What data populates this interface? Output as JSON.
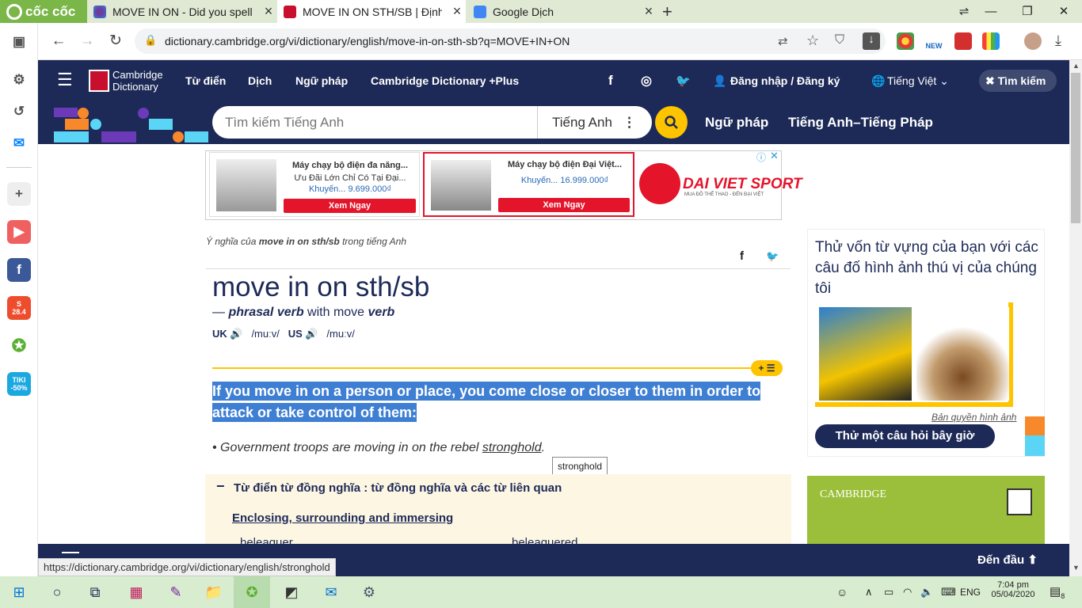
{
  "browser": {
    "brand": "cốc cốc",
    "tabs": [
      {
        "title": "MOVE IN ON - Did you spell i",
        "active": false,
        "icon": "search-globe-icon"
      },
      {
        "title": "MOVE IN ON STH/SB | Định n",
        "active": true,
        "icon": "cambridge-shield-icon"
      },
      {
        "title": "Google Dịch",
        "active": false,
        "icon": "google-translate-icon"
      }
    ],
    "url": "dictionary.cambridge.org/vi/dictionary/english/move-in-on-sth-sb?q=MOVE+IN+ON",
    "status_url": "https://dictionary.cambridge.org/vi/dictionary/english/stronghold",
    "new_badge": "NEW"
  },
  "sidebar": {
    "shopee_badge": "28.4",
    "tiki_badge": "TIKI -50%"
  },
  "site": {
    "logo_line1": "Cambridge",
    "logo_line2": "Dictionary",
    "nav": [
      "Từ điển",
      "Dịch",
      "Ngữ pháp",
      "Cambridge Dictionary +Plus"
    ],
    "login": "Đăng nhập / Đăng ký",
    "language": "Tiếng Việt",
    "search_toggle": "Tìm kiếm",
    "search_placeholder": "Tìm kiếm Tiếng Anh",
    "search_lang": "Tiếng Anh",
    "sub_links": [
      "Ngữ pháp",
      "Tiếng Anh–Tiếng Pháp"
    ]
  },
  "ads": {
    "ad1": {
      "title": "Máy chạy bộ điện đa năng...",
      "sub": "Ưu Đãi Lớn Chỉ Có Tại Đại...",
      "price": "Khuyến... 9.699.000₫",
      "btn": "Xem Ngay"
    },
    "ad2": {
      "title": "Máy chạy bộ điện Đại Việt...",
      "price": "Khuyến... 16.999.000₫",
      "btn": "Xem Ngay"
    },
    "brand": "DAI VIET SPORT",
    "brand_sub": "MUA ĐỒ THỂ THAO - ĐẾN ĐẠI VIỆT"
  },
  "entry": {
    "meaning_prefix": "Ý nghĩa của ",
    "meaning_word": "move in on sth/sb",
    "meaning_suffix": " trong tiếng Anh",
    "headword": "move in on sth/sb",
    "pos_dash": "— ",
    "pos": "phrasal verb",
    "pos_with": " with move ",
    "pos_verb": "verb",
    "uk": "UK",
    "us": "US",
    "pron_uk": "/muːv/",
    "pron_us": "/muːv/",
    "definition": "If you move in on a person or place, you come close or closer to them in order to attack or take control of them:",
    "example_pre": "Government troops are moving in on the rebel ",
    "example_link": "stronghold",
    "example_post": ".",
    "tooltip": "stronghold",
    "thesaurus_title": "Từ điển từ đồng nghĩa : từ đồng nghĩa và các từ liên quan",
    "thesaurus_sub": "Enclosing, surrounding and immersing",
    "thesaurus_words": [
      "beleaguer",
      "beleaguered"
    ]
  },
  "quiz": {
    "title": "Thử vốn từ vựng của bạn với các câu đố hình ảnh thú vị của chúng tôi",
    "credit": "Bản quyền hình ảnh",
    "button": "Thử một câu hỏi bây giờ"
  },
  "promo": {
    "brand": "CAMBRIDGE"
  },
  "footer": {
    "back_to_top": "Đến đầu"
  },
  "taskbar": {
    "lang": "ENG",
    "time": "7:04 pm",
    "date": "05/04/2020",
    "notif": "8"
  },
  "colors": {
    "navy": "#1d2a57",
    "yellow": "#fec400",
    "highlight": "#3f7fd3",
    "browser_green": "#7ab648"
  }
}
